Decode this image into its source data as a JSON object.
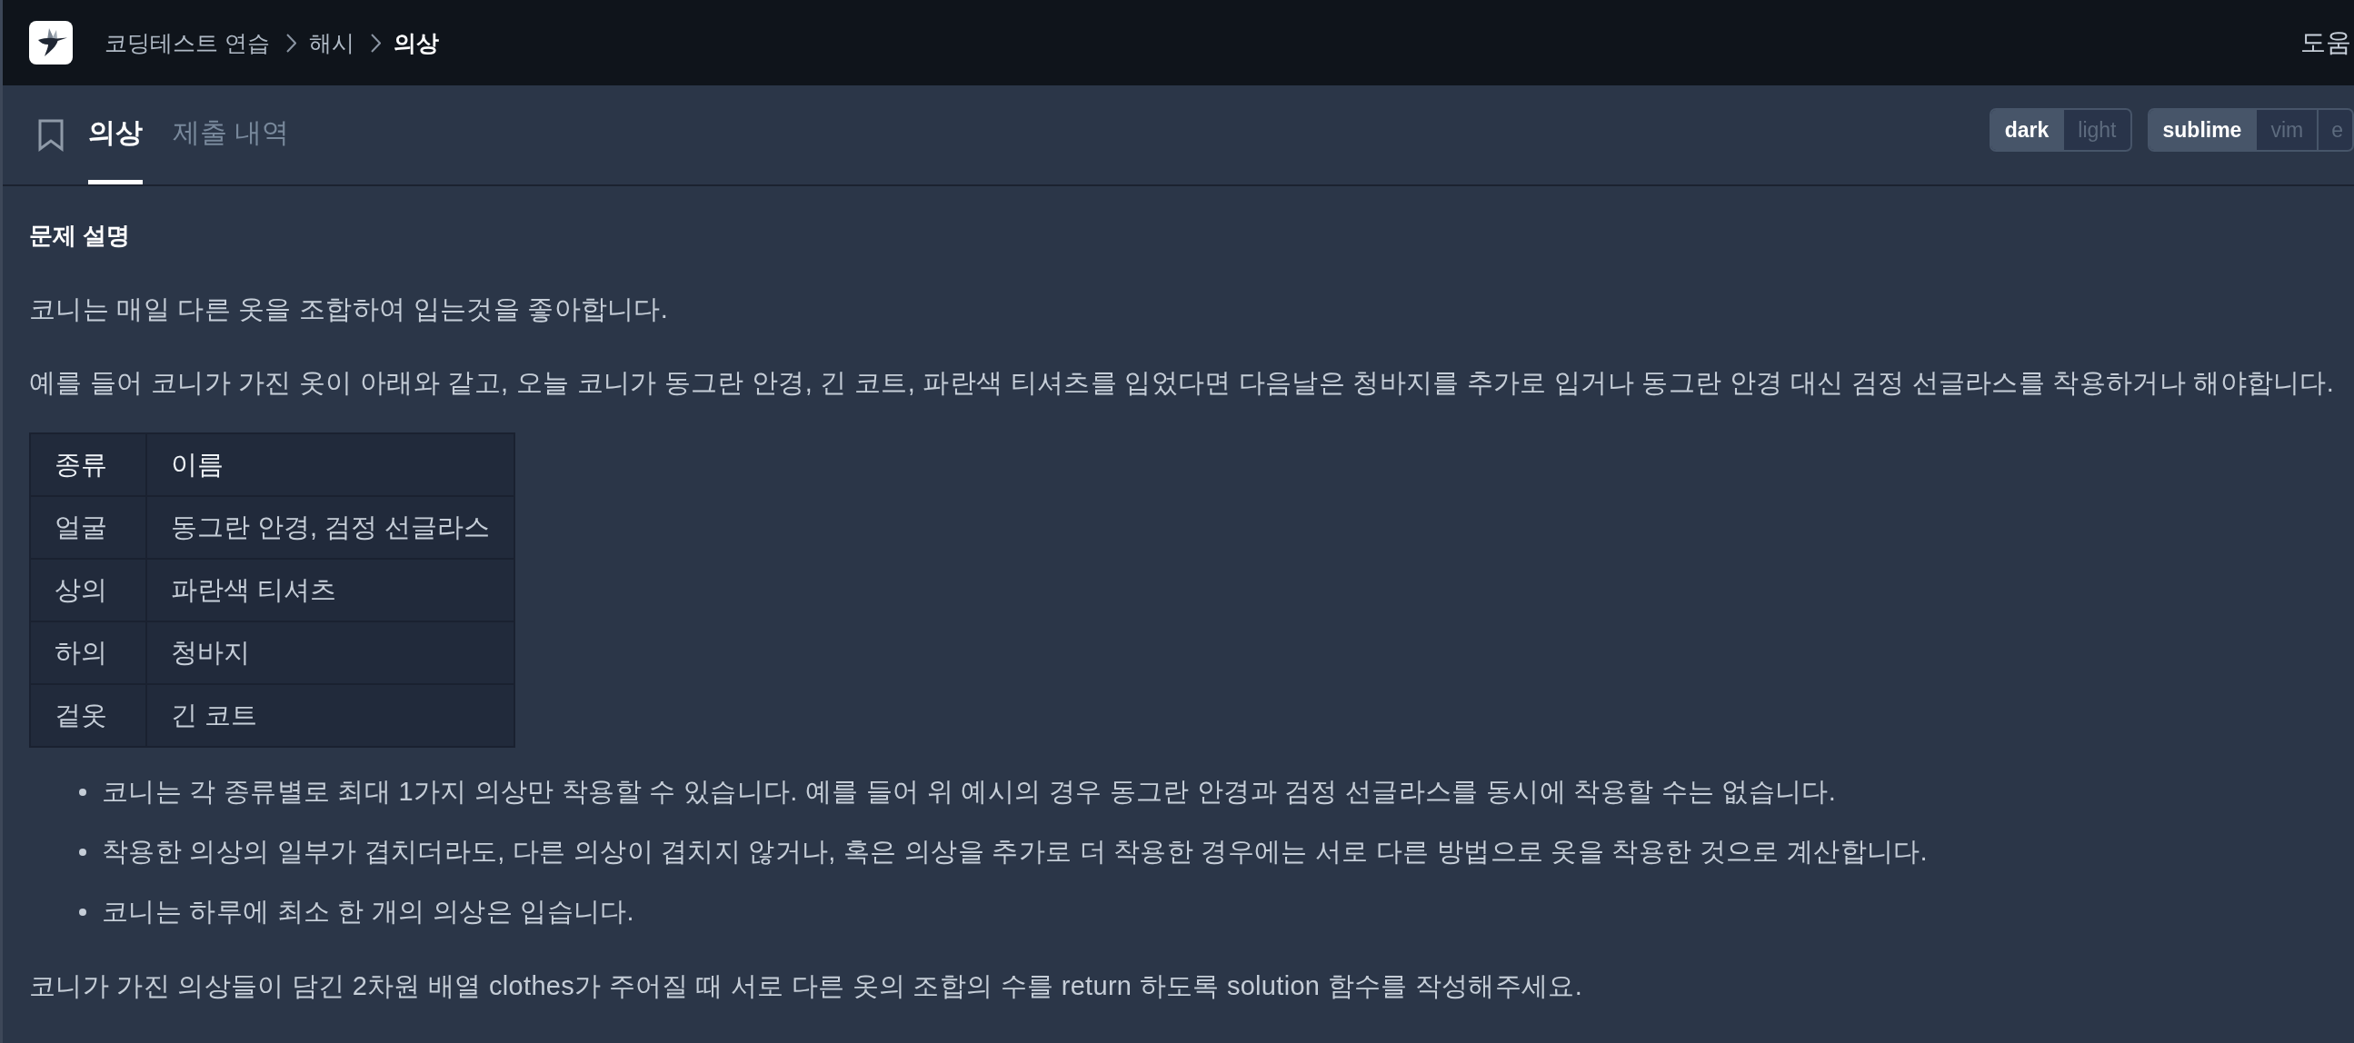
{
  "header": {
    "breadcrumb": [
      {
        "label": "코딩테스트 연습",
        "current": false
      },
      {
        "label": "해시",
        "current": false
      },
      {
        "label": "의상",
        "current": true
      }
    ],
    "help": "도움"
  },
  "tabs": [
    {
      "label": "의상",
      "selected": true
    },
    {
      "label": "제출 내역",
      "selected": false
    }
  ],
  "theme_options": [
    {
      "label": "dark",
      "selected": true
    },
    {
      "label": "light",
      "selected": false
    }
  ],
  "keymap_options": [
    {
      "label": "sublime",
      "selected": true
    },
    {
      "label": "vim",
      "selected": false
    },
    {
      "label": "e",
      "selected": false
    }
  ],
  "description": {
    "heading": "문제 설명",
    "paragraphs": [
      "코니는 매일 다른 옷을 조합하여 입는것을 좋아합니다.",
      "예를 들어 코니가 가진 옷이 아래와 같고, 오늘 코니가 동그란 안경, 긴 코트, 파란색 티셔츠를 입었다면 다음날은 청바지를 추가로 입거나 동그란 안경 대신 검정 선글라스를 착용하거나 해야합니다."
    ],
    "table": {
      "columns": [
        "종류",
        "이름"
      ],
      "rows": [
        [
          "얼굴",
          "동그란 안경, 검정 선글라스"
        ],
        [
          "상의",
          "파란색 티셔츠"
        ],
        [
          "하의",
          "청바지"
        ],
        [
          "겉옷",
          "긴 코트"
        ]
      ]
    },
    "bullets": [
      "코니는 각 종류별로 최대 1가지 의상만 착용할 수 있습니다. 예를 들어 위 예시의 경우 동그란 안경과 검정 선글라스를 동시에 착용할 수는 없습니다.",
      "착용한 의상의 일부가 겹치더라도, 다른 의상이 겹치지 않거나, 혹은 의상을 추가로 더 착용한 경우에는 서로 다른 방법으로 옷을 착용한 것으로 계산합니다.",
      "코니는 하루에 최소 한 개의 의상은 입습니다."
    ],
    "closing": "코니가 가진 의상들이 담긴 2차원 배열 clothes가 주어질 때 서로 다른 옷의 조합의 수를 return 하도록 solution 함수를 작성해주세요."
  }
}
